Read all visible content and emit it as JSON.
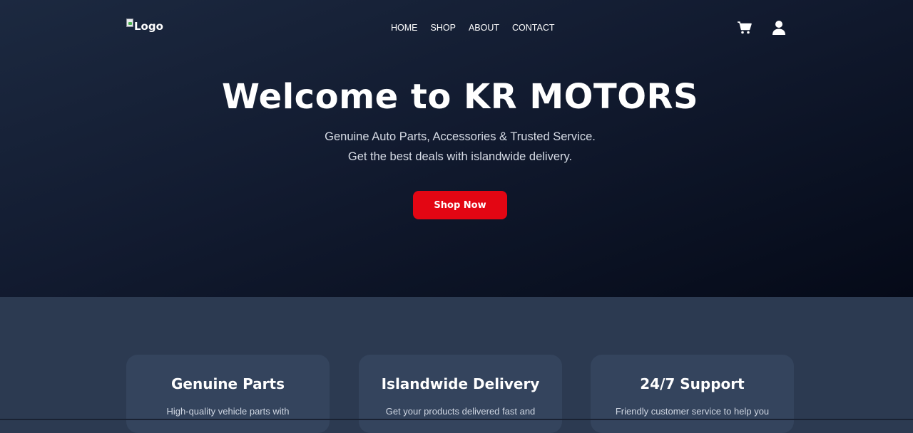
{
  "nav": {
    "logo_alt": "Logo",
    "items": [
      {
        "label": "HOME"
      },
      {
        "label": "SHOP"
      },
      {
        "label": "ABOUT"
      },
      {
        "label": "CONTACT"
      }
    ],
    "icons": [
      "cart-icon",
      "user-icon"
    ]
  },
  "hero": {
    "title": "Welcome to KR MOTORS",
    "subtitle_line1": "Genuine Auto Parts, Accessories & Trusted Service.",
    "subtitle_line2": "Get the best deals with islandwide delivery.",
    "cta_label": "Shop Now"
  },
  "features": [
    {
      "title": "Genuine Parts",
      "text": "High-quality vehicle parts with"
    },
    {
      "title": "Islandwide Delivery",
      "text": "Get your products delivered fast and"
    },
    {
      "title": "24/7 Support",
      "text": "Friendly customer service to help you"
    }
  ],
  "colors": {
    "accent": "#e30613",
    "hero_bg": "#121b30",
    "section_bg": "#2c3a51",
    "card_bg": "#34445d"
  }
}
